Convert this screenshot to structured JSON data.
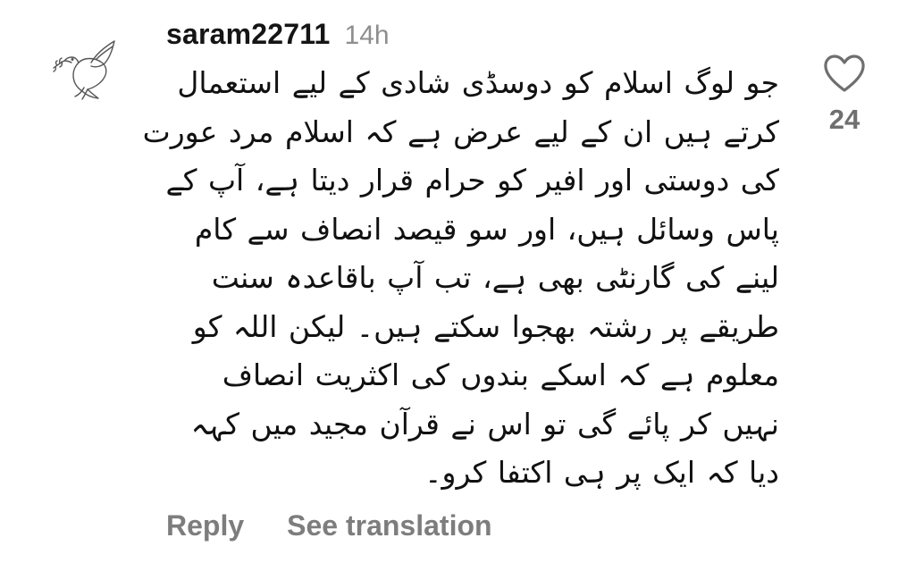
{
  "comment": {
    "username": "saram22711",
    "time": "14h",
    "avatar_icon": "dove-with-olive-branch-icon",
    "lines": [
      "جو لوگ اسلام کو دوسڈی شادی کے لیے استعمال",
      "کرتے ہیں ان کے لیے عرض ہے کہ اسلام مرد عورت",
      "کی دوستی اور افیر کو حرام قرار دیتا ہے، آپ کے",
      "پاس وسائل ہیں، اور سو قیصد انصاف سے کام",
      "لینے کی گارنٹی بھی ہے، تب آپ باقاعدہ سنت",
      "طریقے پر رشتہ بھجوا سکتے ہیں۔ لیکن اللہ کو",
      "معلوم ہے کہ اسکے بندوں کی اکثریت انصاف",
      "نہیں کر پائے گی تو اس نے قرآن مجید میں کہہ",
      "دیا کہ ایک پر ہی اکتفا کرو۔"
    ],
    "like_icon": "heart-outline-icon",
    "like_count": "24",
    "reply_label": "Reply",
    "translate_label": "See translation"
  }
}
